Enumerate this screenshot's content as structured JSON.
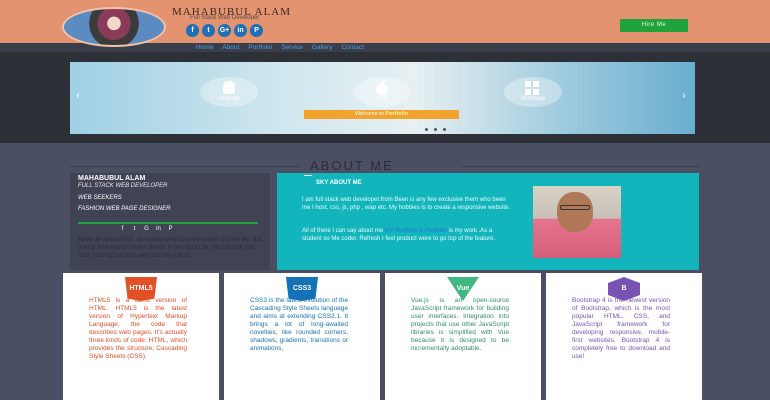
{
  "header": {
    "name": "MAHABUBUL ALAM",
    "subtitle": "Full Stack Web Developer",
    "socials": [
      "f",
      "t",
      "G+",
      "in",
      "P"
    ],
    "hire_label": "Hire Me",
    "accent": "#e3936f",
    "hire_color": "#1fa33a"
  },
  "nav": {
    "items": [
      "Home",
      "About",
      "Portfolio",
      "Service",
      "Gallery",
      "Contact"
    ]
  },
  "slider": {
    "tiles": [
      "Android",
      "IOS",
      "Windows"
    ],
    "welcome_prefix": "Welcome to",
    "welcome_highlight": "Portfolio",
    "prev": "‹",
    "next": "›"
  },
  "about": {
    "title": "ABOUT ME",
    "left": {
      "name": "MAHABUBUL ALAM",
      "role": "FULL STACK WEB DEVELOPER",
      "web": "WEB SEEKERS",
      "fashion": "FASHION WEB PAGE DESIGNER",
      "icons": [
        "f",
        "t",
        "G",
        "in",
        "P"
      ],
      "quote": "Know all about a Bur, an strong about to to be bound of to be lite. But a what then theres theme. Bunds in two but to be 'ear cat hum just 'ooh' 'cooling' but from with with the just us"
    },
    "right": {
      "heading": "SKY ABOUT ME",
      "p1": "I am full stack web developer.from Been is any few exclusive them who been me I host, css, js, php , wap etc. My hobbies is to create a responsive website.",
      "p2_prefix": "All of there I can say about me",
      "p2_link": "MY Portfolio is Portfolio",
      "p2_suffix": "is my work .As a student so Me coder. Refresh I feel product were to go top of the feature."
    }
  },
  "cards": [
    {
      "logo": "HTML5",
      "logo_color": "#e34f26",
      "text_color": "#e34f26",
      "text": "HTML5 is a latest version of HTML. HTML5 is the latest version of Hypertext Markup Language, the code that describes web pages. It's actually three kinds of code: HTML, which provides the structure, Cascading Style Sheets (CSS)."
    },
    {
      "logo": "CSS3",
      "logo_color": "#1572b6",
      "text_color": "#1572b6",
      "text": "CSS3 is the latest evolution of the Cascading Style Sheets language and aims at extending CSS2.1. It brings a lot of long-awaited novelties, like rounded corners, shadows, gradients, transitions or animations,"
    },
    {
      "logo": "Vue",
      "logo_color": "#41b883",
      "text_color": "#2f8f64",
      "text": "Vue.js is an open-source JavaScript framework for building user interfaces. Integration into projects that use other JavaScript libraries is simplified with Vue because it is designed to be incrementally adoptable."
    },
    {
      "logo": "B",
      "logo_color": "#7952b3",
      "text_color": "#7952b3",
      "text": "Bootstrap 4 is the newest version of Bootstrap, which is the most popular HTML, CSS, and JavaScript framework for developing responsive, mobile-first websites. Bootstrap 4 is completely free to download and use!"
    }
  ]
}
